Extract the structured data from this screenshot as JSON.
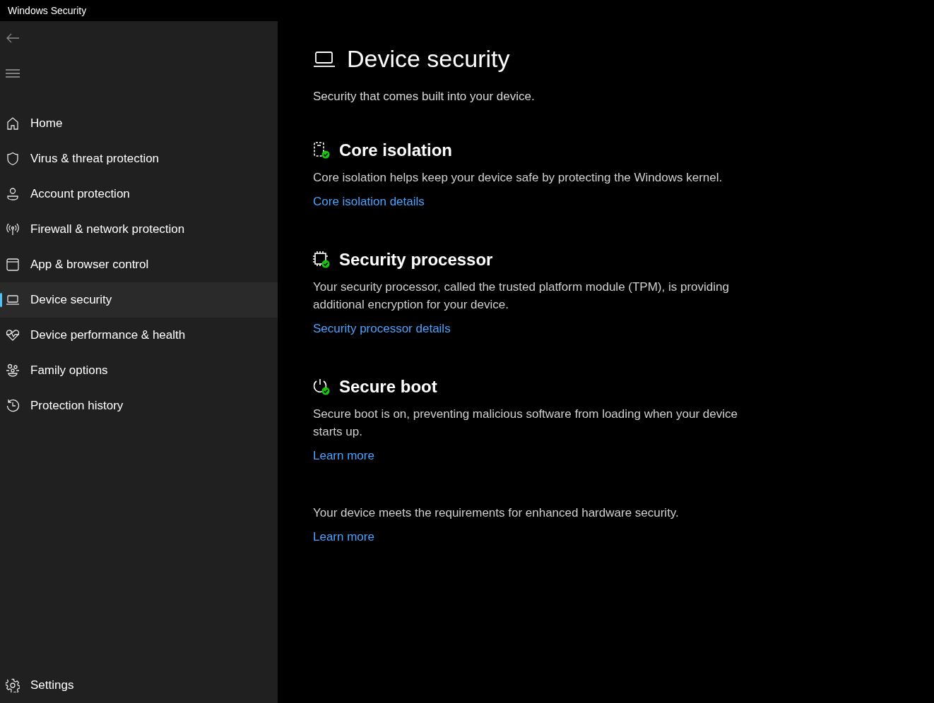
{
  "window": {
    "title": "Windows Security"
  },
  "sidebar": {
    "items": [
      {
        "label": "Home",
        "kind": "home",
        "selected": false
      },
      {
        "label": "Virus & threat protection",
        "kind": "shield",
        "selected": false
      },
      {
        "label": "Account protection",
        "kind": "person",
        "selected": false
      },
      {
        "label": "Firewall & network protection",
        "kind": "antenna",
        "selected": false
      },
      {
        "label": "App & browser control",
        "kind": "window",
        "selected": false
      },
      {
        "label": "Device security",
        "kind": "laptop",
        "selected": true
      },
      {
        "label": "Device performance & health",
        "kind": "heart",
        "selected": false
      },
      {
        "label": "Family options",
        "kind": "family",
        "selected": false
      },
      {
        "label": "Protection history",
        "kind": "history",
        "selected": false
      }
    ],
    "settings": {
      "label": "Settings"
    }
  },
  "page": {
    "title": "Device security",
    "subtitle": "Security that comes built into your device.",
    "sections": [
      {
        "kind": "core",
        "title": "Core isolation",
        "healthy": true,
        "description": "Core isolation helps keep your device safe by protecting the Windows kernel.",
        "link": "Core isolation details"
      },
      {
        "kind": "processor",
        "title": "Security processor",
        "healthy": true,
        "description": "Your security processor, called the trusted platform module (TPM), is providing additional encryption for your device.",
        "link": "Security processor details"
      },
      {
        "kind": "boot",
        "title": "Secure boot",
        "healthy": true,
        "description": "Secure boot is on, preventing malicious software from loading when your device starts up.",
        "link": "Learn more"
      }
    ],
    "footer": {
      "text": "Your device meets the requirements for enhanced hardware security.",
      "link": "Learn more"
    }
  }
}
